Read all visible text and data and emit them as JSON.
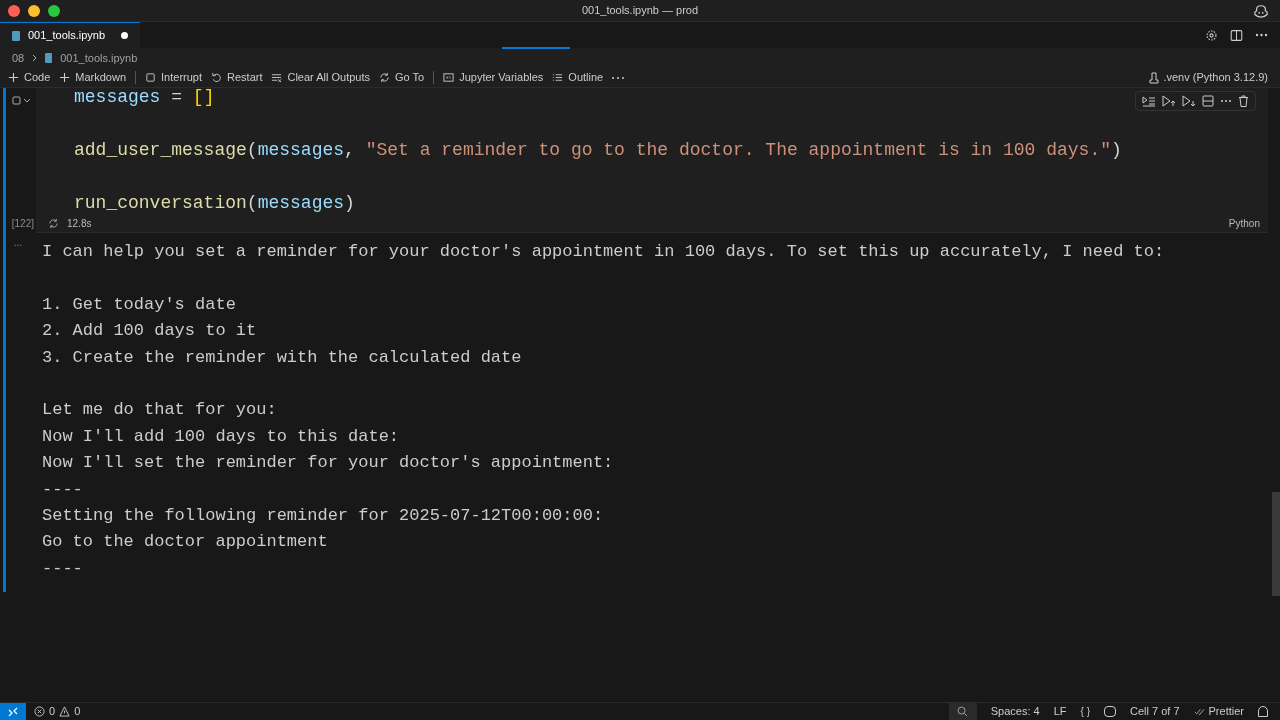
{
  "window": {
    "title": "001_tools.ipynb — prod"
  },
  "tabs": [
    {
      "label": "001_tools.ipynb",
      "selected": true,
      "modified": true
    }
  ],
  "breadcrumb": [
    "08",
    "001_tools.ipynb"
  ],
  "toolbar": [
    {
      "kind": "plus",
      "label": "Code"
    },
    {
      "kind": "plus",
      "label": "Markdown"
    },
    {
      "kind": "sep"
    },
    {
      "kind": "stop",
      "label": "Interrupt"
    },
    {
      "kind": "restart",
      "label": "Restart"
    },
    {
      "kind": "clear",
      "label": "Clear All Outputs"
    },
    {
      "kind": "goto",
      "label": "Go To"
    },
    {
      "kind": "sep"
    },
    {
      "kind": "variables",
      "label": "Jupyter Variables"
    },
    {
      "kind": "outline",
      "label": "Outline"
    },
    {
      "kind": "more"
    }
  ],
  "kernel": ".venv (Python 3.12.9)",
  "cell": {
    "code": [
      [
        {
          "kind": "variable",
          "text": "messages"
        },
        {
          "kind": "punct",
          "text": " = "
        },
        {
          "kind": "bracket",
          "text": "[]"
        }
      ],
      [
        {
          "kind": "function",
          "text": "add_user_message"
        },
        {
          "kind": "punct",
          "text": "("
        },
        {
          "kind": "variable",
          "text": "messages"
        },
        {
          "kind": "punct",
          "text": ", "
        },
        {
          "kind": "string",
          "text": "\"Set a reminder to go to the doctor. The appointment is in 100 days.\""
        },
        {
          "kind": "punct",
          "text": ")"
        }
      ],
      [
        {
          "kind": "function",
          "text": "run_conversation"
        },
        {
          "kind": "punct",
          "text": "("
        },
        {
          "kind": "variable",
          "text": "messages"
        },
        {
          "kind": "punct",
          "text": ")"
        }
      ]
    ],
    "execution_count": "[122]",
    "duration": "12.8s",
    "language": "Python"
  },
  "output": {
    "more": "...",
    "paragraphs": [
      [
        "I can help you set a reminder for your doctor's appointment in 100 days. To set this up accurately, I need to:"
      ],
      [
        "1. Get today's date",
        "2. Add 100 days to it",
        "3. Create the reminder with the calculated date"
      ],
      [
        "Let me do that for you:",
        "Now I'll add 100 days to this date:",
        "Now I'll set the reminder for your doctor's appointment:",
        "----",
        "Setting the following reminder for 2025-07-12T00:00:00:",
        "Go to the doctor appointment",
        "----"
      ]
    ]
  },
  "status_bar": {
    "errors": "0",
    "warnings": "0",
    "spaces": "Spaces: 4",
    "eol": "LF",
    "braces": "{ }",
    "cell": "Cell 7 of 7",
    "formatter": "Prettier"
  }
}
